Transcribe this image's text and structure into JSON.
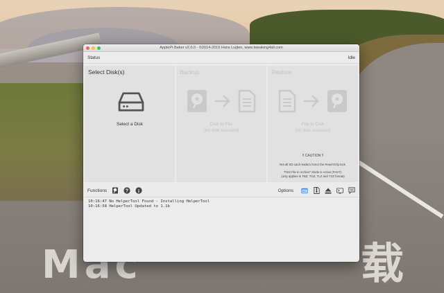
{
  "window": {
    "title": "ApplePi-Baker v2.0.0 - ©2014-2019 Hans Luijten, www.tweaking4all.com"
  },
  "statusbar": {
    "label": "Status",
    "state": "Idle"
  },
  "panels": {
    "select": {
      "title": "Select Disk(s)",
      "button_label": "Select a Disk",
      "icon": "hard-drive-icon"
    },
    "backup": {
      "title": "Backup",
      "line1": "Disk to File",
      "line2": "(no disk selected)"
    },
    "restore": {
      "title": "Restore",
      "line1": "File to Disk",
      "line2": "(no disk selected)",
      "caution_title": "!! CAUTION !!",
      "caution_text": "Not all SD-card readers honor the Read-Only lock.",
      "note_line1": "\"First File in Archive\" Mode is Active (FAST).",
      "note_line2": "(only applies to TBZ, TGZ, TLZ and TXZ format)"
    }
  },
  "functions": {
    "label": "Functions",
    "icons": [
      "disk-utility-icon",
      "help-icon",
      "info-icon"
    ]
  },
  "options": {
    "label": "Options",
    "icons": [
      "window-icon",
      "zip-file-icon",
      "eject-icon",
      "terminal-icon",
      "message-icon"
    ]
  },
  "log": {
    "lines": [
      {
        "time": "10:16:47",
        "text": "No HelperTool Found - Installing HelperTool"
      },
      {
        "time": "10:16:58",
        "text": "HelperTool Updated to 1.1b"
      }
    ]
  },
  "colors": {
    "accent": "#2f7bd8",
    "disabled_icon": "#c9c9c9",
    "active_icon": "#555555"
  }
}
